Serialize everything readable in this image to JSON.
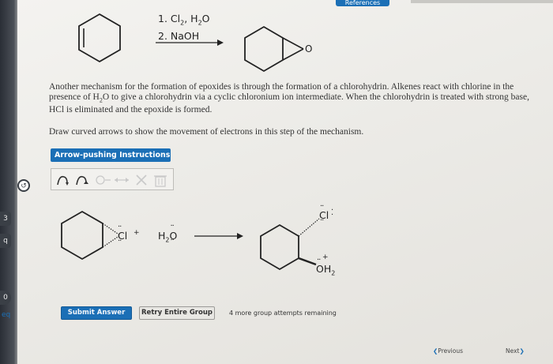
{
  "header": {
    "references_tab": "References"
  },
  "reaction1": {
    "step1": "1. Cl",
    "step1_sub2": "2",
    "step1_mid": ", H",
    "step1_sub2b": "2",
    "step1_end": "O",
    "step2": "2. NaOH",
    "product_o": "O"
  },
  "question": {
    "paragraph_part1": "Another mechanism for the formation of epoxides is through the formation of a chlorohydrin. Alkenes react with chlorine in the presence of H",
    "paragraph_sub": "2",
    "paragraph_part2": "O to give a chlorohydrin via a cyclic chloronium ion intermediate. When the chlorohydrin is treated with strong base, HCl is eliminated and the epoxide is formed.",
    "instruction": "Draw curved arrows to show the movement of electrons in this step of the mechanism."
  },
  "toolbar": {
    "instructions_button": "Arrow-pushing Instructions"
  },
  "mechanism": {
    "cl_plus": "Cl",
    "plus": "+",
    "water": "H",
    "water_sub": "2",
    "water_o": "O",
    "product_cl": "Cl",
    "product_oh": "OH",
    "product_oh_sub": "2",
    "product_plus": "+"
  },
  "actions": {
    "submit": "Submit Answer",
    "retry": "Retry Entire Group",
    "remaining": "4 more group attempts remaining"
  },
  "navigation": {
    "previous": "Previous",
    "next": "Next"
  },
  "edge": {
    "tab1": "3",
    "tab2": "q",
    "tab3": "0",
    "label": "eq"
  },
  "colors": {
    "accent": "#1b6fb6",
    "bond": "#222222"
  }
}
